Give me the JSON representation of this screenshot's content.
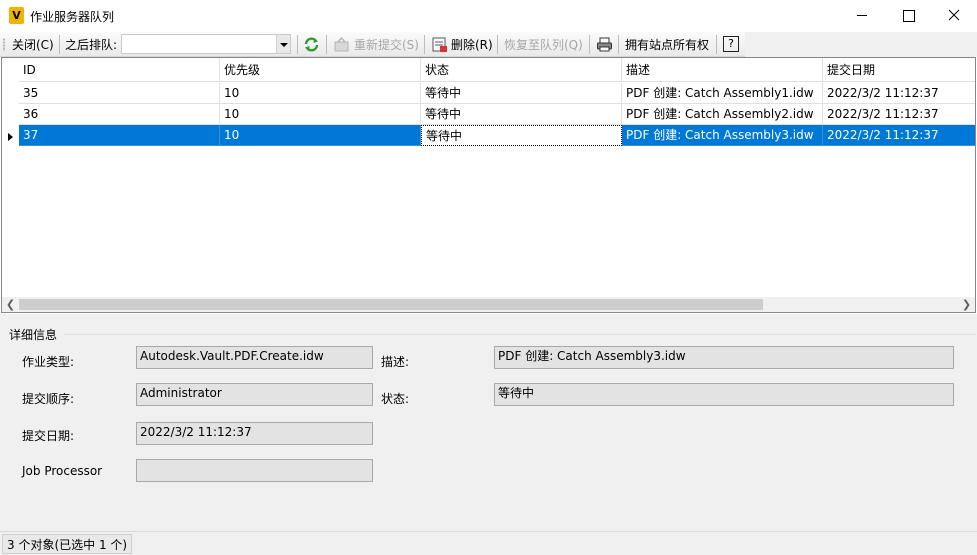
{
  "window": {
    "app_icon_letter": "V",
    "title": "作业服务器队列"
  },
  "toolbar": {
    "close": "关闭(C)",
    "queue_after_label": "之后排队:",
    "queue_after_value": "",
    "resubmit": "重新提交(S)",
    "delete": "删除(R)",
    "restore": "恢复至队列(Q)",
    "all_sites": "拥有站点所有权",
    "help": "?"
  },
  "grid": {
    "columns": [
      "ID",
      "优先级",
      "状态",
      "描述",
      "提交日期"
    ],
    "rows": [
      {
        "id": "35",
        "priority": "10",
        "status": "等待中",
        "description": "PDF 创建: Catch Assembly1.idw",
        "date": "2022/3/2 11:12:37"
      },
      {
        "id": "36",
        "priority": "10",
        "status": "等待中",
        "description": "PDF 创建: Catch Assembly2.idw",
        "date": "2022/3/2 11:12:37"
      },
      {
        "id": "37",
        "priority": "10",
        "status": "等待中",
        "description": "PDF 创建: Catch Assembly3.idw",
        "date": "2022/3/2 11:12:37"
      }
    ],
    "selected_row_id": "37"
  },
  "details": {
    "title": "详细信息",
    "job_type_label": "作业类型:",
    "job_type_value": "Autodesk.Vault.PDF.Create.idw",
    "submitter_label": "提交顺序:",
    "submitter_value": "Administrator",
    "submit_date_label": "提交日期:",
    "submit_date_value": "2022/3/2 11:12:37",
    "job_processor_label": "Job Processor",
    "job_processor_value": "",
    "description_label": "描述:",
    "description_value": "PDF 创建: Catch Assembly3.idw",
    "status_label": "状态:",
    "status_value": "等待中"
  },
  "status_bar": {
    "text": "3 个对象(已选中 1 个)"
  }
}
